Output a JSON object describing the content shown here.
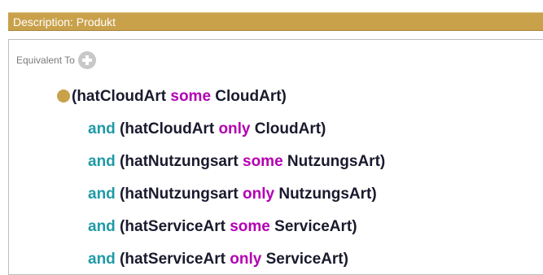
{
  "header": {
    "title": "Description: Produkt"
  },
  "section": {
    "label": "Equivalent To",
    "add_icon": "add-circle-icon"
  },
  "colors": {
    "header_bg": "#c9a14b",
    "keyword_and": "#1f9aa6",
    "keyword_quantifier": "#b300b3",
    "text": "#1a1a2e"
  },
  "expression": {
    "lines": [
      {
        "prefix": "",
        "open": "(",
        "property": "hatCloudArt ",
        "quantifier": "some",
        "filler": " CloudArt)"
      },
      {
        "prefix": "and",
        "open": " (",
        "property": "hatCloudArt ",
        "quantifier": "only",
        "filler": " CloudArt)"
      },
      {
        "prefix": "and",
        "open": " (",
        "property": "hatNutzungsart ",
        "quantifier": "some",
        "filler": " NutzungsArt)"
      },
      {
        "prefix": "and",
        "open": " (",
        "property": "hatNutzungsart ",
        "quantifier": "only",
        "filler": " NutzungsArt)"
      },
      {
        "prefix": "and",
        "open": " (",
        "property": "hatServiceArt ",
        "quantifier": "some",
        "filler": " ServiceArt)"
      },
      {
        "prefix": "and",
        "open": " (",
        "property": "hatServiceArt ",
        "quantifier": "only",
        "filler": " ServiceArt)"
      }
    ]
  }
}
